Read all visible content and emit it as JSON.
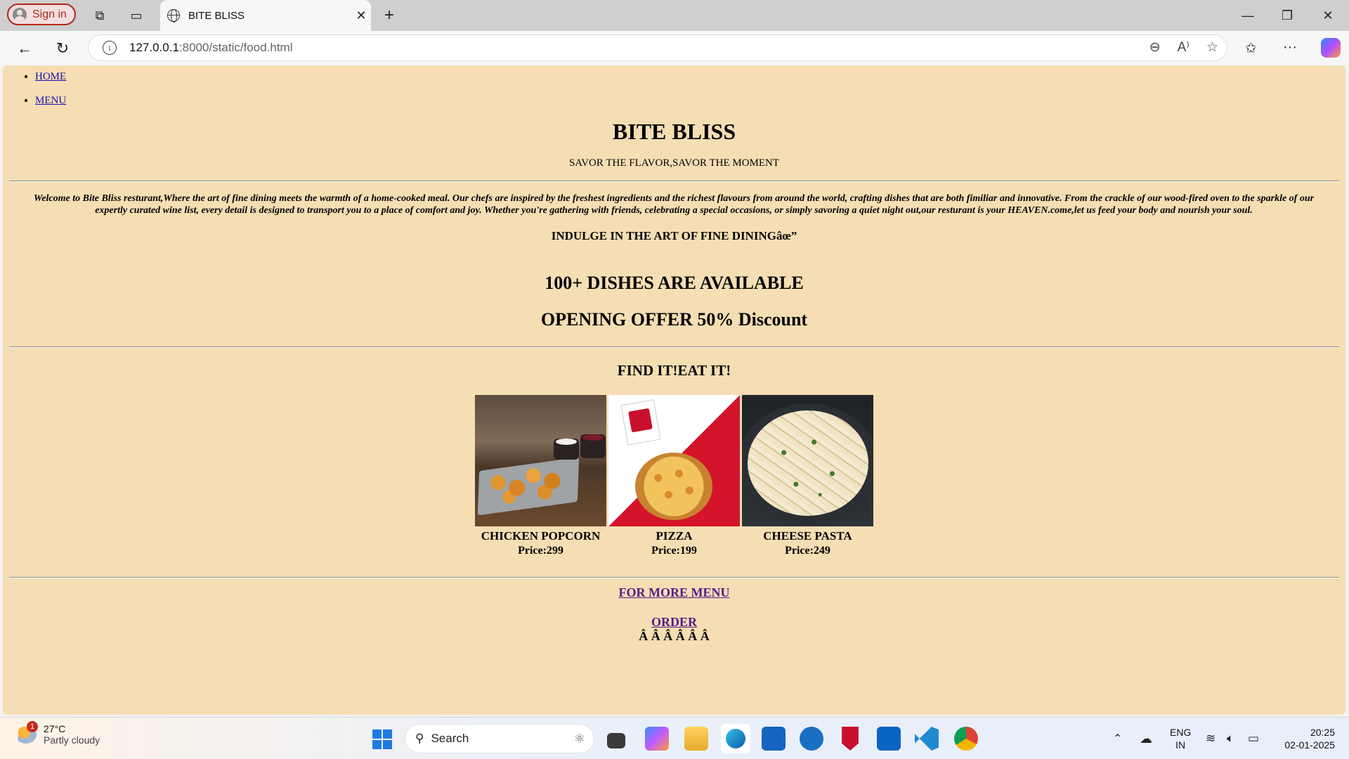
{
  "browser": {
    "signin_label": "Sign in",
    "tab_title": "BITE BLISS",
    "url_host": "127.0.0.1",
    "url_rest": ":8000/static/food.html"
  },
  "page": {
    "nav": [
      "HOME",
      "MENU"
    ],
    "brand": "BITE BLISS",
    "tagline": "SAVOR THE FLAVOR,SAVOR THE MOMENT",
    "welcome": "Welcome to Bite Bliss resturant,Where the art of fine dining meets the warmth of a home-cooked meal. Our chefs are inspired by the freshest ingredients and the richest flavours from around the world, crafting dishes that are both fimiliar and innovative. From the crackle of our wood-fired oven to the sparkle of our expertly curated wine list, every detail is designed to transport you to a place of comfort and joy. Whether you're gathering with friends, celebrating a special occasions, or simply savoring a quiet night out,our resturant is your HEAVEN.come,let us feed your body and nourish your soul.",
    "indulge": "INDULGE IN THE ART OF FINE DININGâœ”",
    "dishes_available": "100+ DISHES ARE AVAILABLE",
    "offer": "OPENING OFFER 50% Discount",
    "find": "FIND IT!EAT IT!",
    "items": [
      {
        "name": "CHICKEN POPCORN",
        "price": "Price:299"
      },
      {
        "name": "PIZZA",
        "price": "Price:199"
      },
      {
        "name": "CHEESE PASTA",
        "price": "Price:249"
      }
    ],
    "more_menu": "FOR MORE MENU",
    "order": "ORDER",
    "junk": "Â Â Â Â Â Â"
  },
  "taskbar": {
    "weather_temp": "27°C",
    "weather_desc": "Partly cloudy",
    "weather_badge": "1",
    "search_placeholder": "Search",
    "lang_line1": "ENG",
    "lang_line2": "IN",
    "time": "20:25",
    "date": "02-01-2025"
  }
}
